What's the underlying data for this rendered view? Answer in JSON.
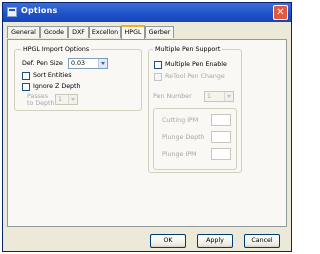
{
  "window": {
    "title": "Options",
    "close_glyph": "✕"
  },
  "tabs": [
    "General",
    "Gcode",
    "DXF",
    "Excellon",
    "HPGL",
    "Gerber"
  ],
  "active_tab": "HPGL",
  "hpgl_import": {
    "title": "HPGL Import Options",
    "pen_size_label": "Def. Pen Size",
    "pen_size_value": "0.03",
    "sort_entities_label": "Sort Entities",
    "sort_entities_checked": false,
    "ignore_z_label": "Ignore Z Depth",
    "ignore_z_checked": false,
    "passes_label_line1": "Passes",
    "passes_label_line2": "to Depth",
    "passes_value": "1"
  },
  "multi_pen": {
    "title": "Multiple Pen Support",
    "enable_label": "Multiple Pen Enable",
    "enable_checked": false,
    "retool_label": "ReTool Pen Change",
    "retool_checked": false,
    "pen_number_label": "Pen Number",
    "pen_number_value": "1",
    "cutting_ipm_label": "Cutting IPM",
    "plunge_depth_label": "Plunge Depth",
    "plunge_ipm_label": "Plunge IPM"
  },
  "buttons": {
    "ok": "OK",
    "apply": "Apply",
    "cancel": "Cancel"
  },
  "colors": {
    "title_bar": "#1e50c8",
    "dialog_bg": "#ece9d8",
    "panel_bg": "#f9f8f4",
    "active_tab_accent": "#f0b030"
  },
  "icons": {
    "title": "app-window-icon",
    "close": "close-icon"
  }
}
